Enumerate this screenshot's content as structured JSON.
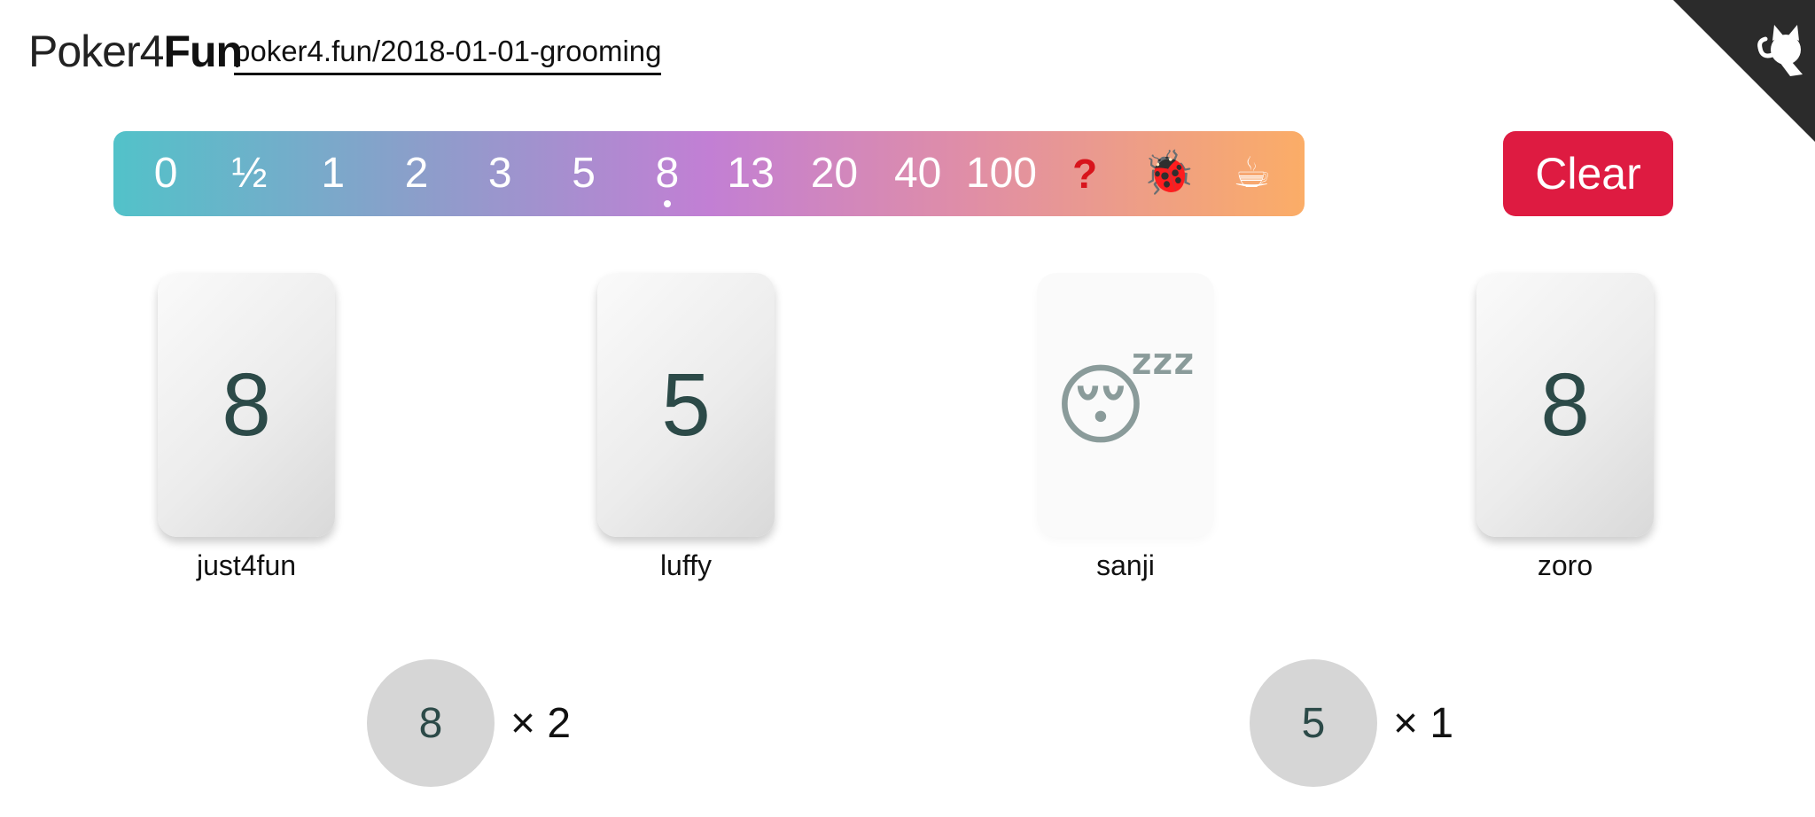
{
  "header": {
    "logo_light": "Poker4",
    "logo_bold": "Fun",
    "room_link": "poker4.fun/2018-01-01-grooming"
  },
  "card_bar": {
    "cards": [
      {
        "label": "0",
        "name": "card-0"
      },
      {
        "label": "½",
        "name": "card-half"
      },
      {
        "label": "1",
        "name": "card-1"
      },
      {
        "label": "2",
        "name": "card-2"
      },
      {
        "label": "3",
        "name": "card-3"
      },
      {
        "label": "5",
        "name": "card-5"
      },
      {
        "label": "8",
        "name": "card-8"
      },
      {
        "label": "13",
        "name": "card-13"
      },
      {
        "label": "20",
        "name": "card-20"
      },
      {
        "label": "40",
        "name": "card-40"
      },
      {
        "label": "100",
        "name": "card-100"
      },
      {
        "label": "?",
        "name": "card-question"
      },
      {
        "label": "🐞",
        "name": "card-bug"
      },
      {
        "label": "☕",
        "name": "card-coffee"
      }
    ],
    "selected": "8",
    "gradient_colors": [
      "#52c2c9",
      "#8a9fca",
      "#c27fd4",
      "#e08ea6",
      "#fbad67"
    ]
  },
  "clear_button": {
    "label": "Clear",
    "color": "#de1b41"
  },
  "players": [
    {
      "name": "just4fun",
      "card": "8"
    },
    {
      "name": "luffy",
      "card": "5"
    },
    {
      "name": "sanji",
      "card": "😴"
    },
    {
      "name": "zoro",
      "card": "8"
    }
  ],
  "results": [
    {
      "value": "8",
      "count": "× 2"
    },
    {
      "value": "5",
      "count": "× 1"
    }
  ],
  "icons": {
    "corner": "github-octocat-icon"
  }
}
